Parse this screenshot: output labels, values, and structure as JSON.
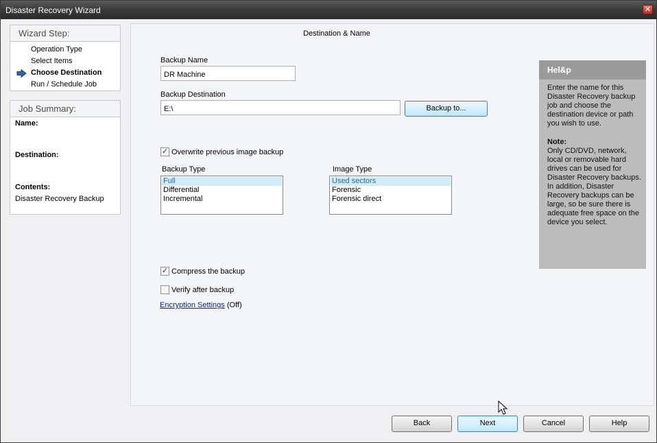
{
  "window": {
    "title": "Disaster Recovery Wizard",
    "close_glyph": "✕"
  },
  "wizard_step": {
    "header": "Wizard Step:",
    "steps": [
      {
        "label": "Operation Type",
        "current": false
      },
      {
        "label": "Select Items",
        "current": false
      },
      {
        "label": "Choose Destination",
        "current": true
      },
      {
        "label": "Run / Schedule Job",
        "current": false
      }
    ]
  },
  "job_summary": {
    "header": "Job Summary:",
    "name_label": "Name:",
    "name_value": "",
    "destination_label": "Destination:",
    "destination_value": "",
    "contents_label": "Contents:",
    "contents_value": "Disaster Recovery Backup"
  },
  "main": {
    "heading": "Destination & Name",
    "backup_name_label": "Backup Name",
    "backup_name_value": "DR Machine",
    "backup_destination_label": "Backup Destination",
    "backup_destination_value": "E:\\",
    "backup_to_label": "Backup to...",
    "overwrite_label": "Overwrite previous image backup",
    "overwrite_checked": true,
    "backup_type_label": "Backup Type",
    "backup_types": [
      {
        "label": "Full",
        "selected": true
      },
      {
        "label": "Differential",
        "selected": false
      },
      {
        "label": "Incremental",
        "selected": false
      }
    ],
    "image_type_label": "Image Type",
    "image_types": [
      {
        "label": "Used sectors",
        "selected": true
      },
      {
        "label": "Forensic",
        "selected": false
      },
      {
        "label": "Forensic direct",
        "selected": false
      }
    ],
    "compress_label": "Compress the backup",
    "compress_checked": true,
    "verify_label": "Verify after backup",
    "verify_checked": false,
    "encryption_link": "Encryption Settings",
    "encryption_status": "(Off)"
  },
  "help": {
    "title": "Hel&p",
    "body": "Enter the name for this Disaster Recovery backup job and choose the destination device or path you wish to use.",
    "note_title": "Note:",
    "note_body": "Only CD/DVD, network, local or removable hard drives can be used for Disaster Recovery backups.  In addition, Disaster Recovery backups can be large, so be sure there is adequate free space on the device you select."
  },
  "footer": {
    "back": "Back",
    "next": "Next",
    "cancel": "Cancel",
    "help": "Help"
  },
  "check_glyph": "✓"
}
